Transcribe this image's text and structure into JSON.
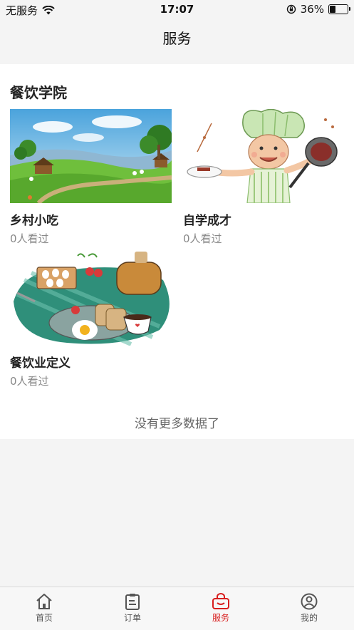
{
  "status_bar": {
    "carrier": "无服务",
    "time": "17:07",
    "battery_percent": "36%"
  },
  "header": {
    "title": "服务"
  },
  "section": {
    "title": "餐饮学院",
    "courses": [
      {
        "name": "乡村小吃",
        "views": "0人看过",
        "image": "countryside-landscape"
      },
      {
        "name": "自学成才",
        "views": "0人看过",
        "image": "cabbage-chef-cartoon"
      },
      {
        "name": "餐饮业定义",
        "views": "0人看过",
        "image": "breakfast-illustration"
      }
    ],
    "no_more_text": "没有更多数据了"
  },
  "tab_bar": {
    "active": "服务",
    "items": [
      {
        "label": "首页",
        "icon": "home-icon"
      },
      {
        "label": "订单",
        "icon": "clipboard-icon"
      },
      {
        "label": "服务",
        "icon": "bag-icon"
      },
      {
        "label": "我的",
        "icon": "user-icon"
      }
    ]
  },
  "colors": {
    "accent": "#d81e1e",
    "background": "#f4f4f4",
    "card": "#ffffff"
  }
}
